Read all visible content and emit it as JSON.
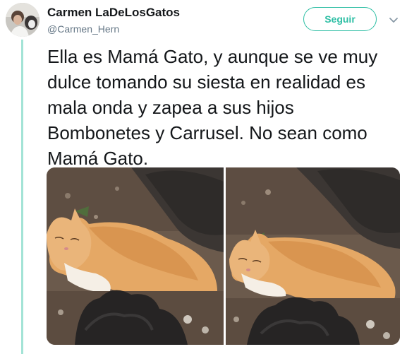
{
  "tweet": {
    "display_name": "Carmen LaDeLosGatos",
    "handle": "@Carmen_Hern",
    "follow_label": "Seguir",
    "text": "Ella es Mamá Gato, y aunque se ve muy\ndulce tomando su siesta en realidad es\nmala onda y zapea a sus hijos\nBombonetes y Carrusel. No sean como\nMamá Gato."
  },
  "icons": {
    "caret": "chevron-down-icon",
    "avatar": "user-avatar"
  },
  "colors": {
    "accent": "#2fbfa5",
    "thread_line": "#a3e3d6",
    "text": "#14171a",
    "muted": "#657786"
  }
}
